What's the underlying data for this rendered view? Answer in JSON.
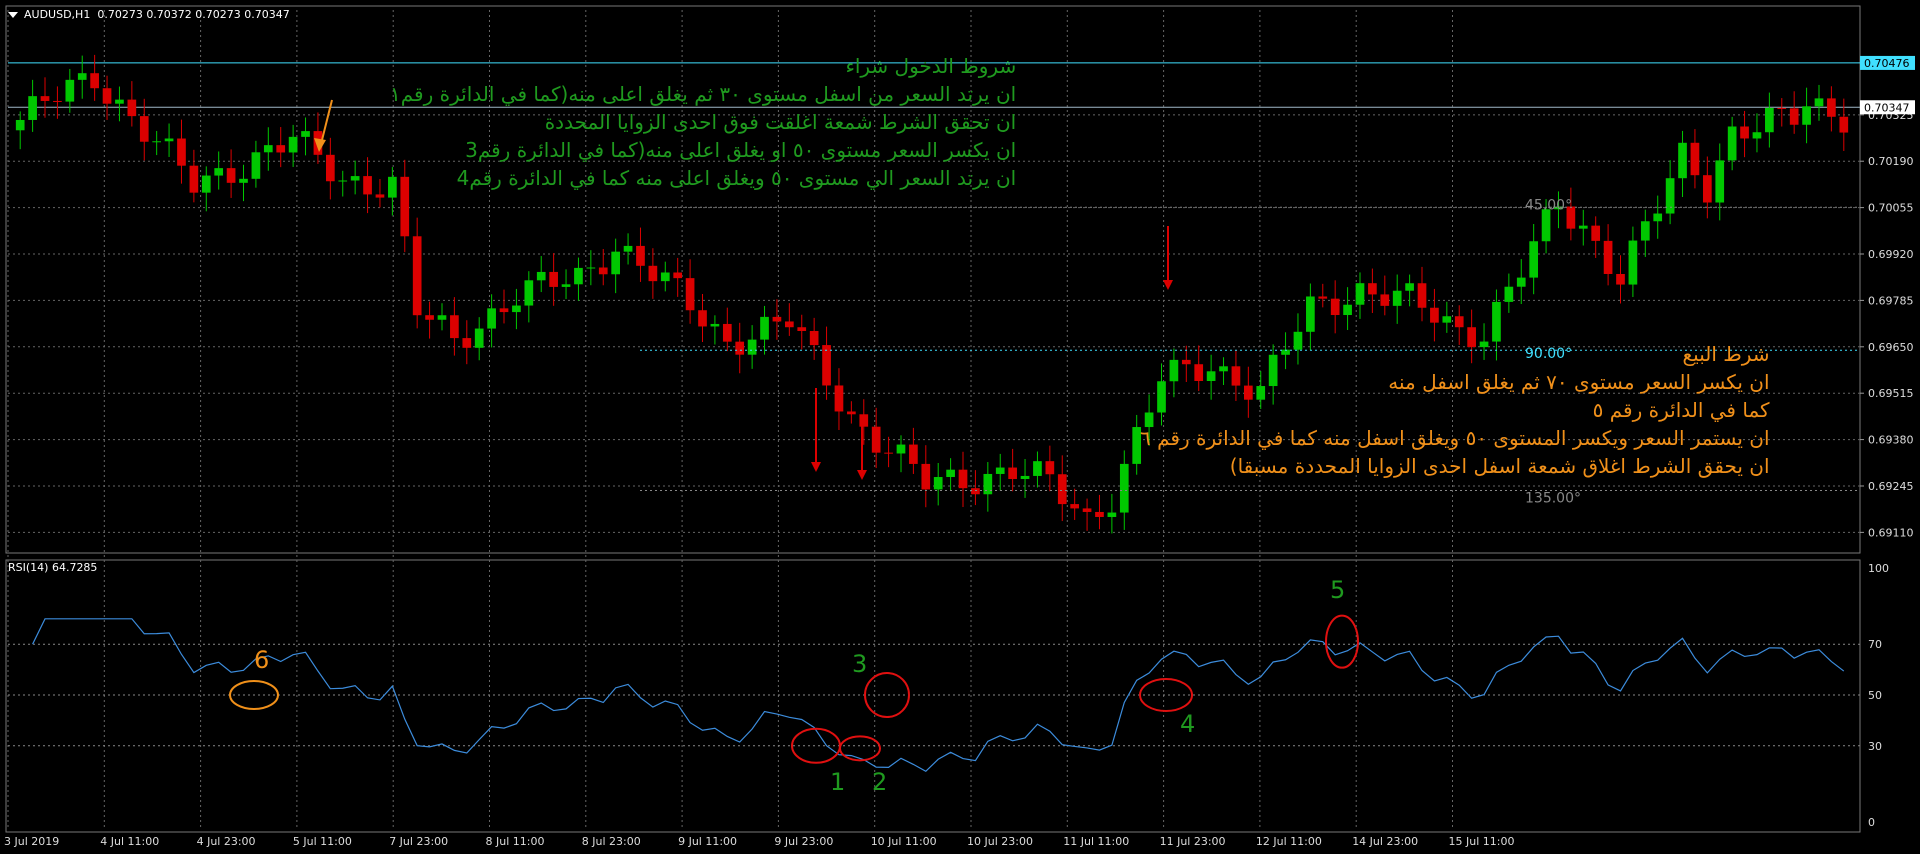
{
  "header": {
    "symbol": "AUDUSD,H1",
    "ohlc": "0.70273 0.70372 0.70273 0.70347"
  },
  "rsi_header": "RSI(14) 64.7285",
  "price_badges": [
    {
      "label": "0.70476",
      "color": "#40e0ff"
    },
    {
      "label": "0.70347",
      "color": "#ffffff"
    }
  ],
  "colors": {
    "bull": "#00c800",
    "bear": "#dc0000",
    "rsi_line": "#3c8cdc",
    "buy_text": "#1f9a1f",
    "sell_text": "#f0901a",
    "circle_red": "#e01010",
    "circle_orange": "#f0901a"
  },
  "angle_labels": [
    {
      "text": "45.00°",
      "color": "#888888"
    },
    {
      "text": "90.00°",
      "color": "#40e0ff"
    },
    {
      "text": "135.00°",
      "color": "#888888"
    }
  ],
  "buy_notes": {
    "title": "شروط الدخول شراء",
    "lines": [
      "ان يرتد السعر من اسفل مستوى ٣٠ ثم يغلق اعلى منه(كما في الدائرة رقم١",
      "ان تحقق الشرط شمعة اغلقت فوق احدى الزوايا المحددة",
      "ان يكسر السعر مستوى ٥٠ او يغلق اعلى منه(كما في الدائرة رقم3",
      "ان يرتد السعر الي مستوى ٥٠ ويغلق اعلى منه كما في الدائرة رقم4"
    ]
  },
  "sell_notes": {
    "title": "شرط البيع",
    "lines": [
      "ان يكسر السعر مستوى ٧٠ ثم يغلق اسفل منه",
      "كما في الدائرة رقم ٥",
      "ان يستمر السعر ويكسر المستوى ٥٠ ويغلق اسفل منه كما في الدائرة رقم ٦",
      "ان يحقق الشرط اغلاق شمعة اسفل احدى الزوايا المحددة مسبقا)"
    ]
  },
  "circle_labels": [
    "1",
    "2",
    "3",
    "4",
    "5",
    "6"
  ],
  "chart_data": [
    {
      "type": "candlestick",
      "title": "AUDUSD,H1",
      "ylim": [
        0.6905,
        0.7063
      ],
      "y_ticks": [
        "0.70325",
        "0.70190",
        "0.70055",
        "0.69920",
        "0.69785",
        "0.69650",
        "0.69515",
        "0.69380",
        "0.69245",
        "0.69110"
      ],
      "x_ticks": [
        "3 Jul 2019",
        "4 Jul 11:00",
        "4 Jul 23:00",
        "5 Jul 11:00",
        "7 Jul 23:00",
        "8 Jul 11:00",
        "8 Jul 23:00",
        "9 Jul 11:00",
        "9 Jul 23:00",
        "10 Jul 11:00",
        "10 Jul 23:00",
        "11 Jul 11:00",
        "11 Jul 23:00",
        "12 Jul 11:00",
        "14 Jul 23:00",
        "15 Jul 11:00"
      ],
      "horizontal_lines": [
        0.70476,
        0.70347
      ],
      "anchors": [
        [
          0,
          0.7031
        ],
        [
          6,
          0.7044
        ],
        [
          10,
          0.7028
        ],
        [
          14,
          0.7012
        ],
        [
          22,
          0.7025
        ],
        [
          26,
          0.7014
        ],
        [
          30,
          0.7012
        ],
        [
          32,
          0.6975
        ],
        [
          35,
          0.6967
        ],
        [
          40,
          0.698
        ],
        [
          45,
          0.6985
        ],
        [
          48,
          0.6995
        ],
        [
          53,
          0.698
        ],
        [
          57,
          0.6967
        ],
        [
          62,
          0.6972
        ],
        [
          67,
          0.6945
        ],
        [
          70,
          0.6935
        ],
        [
          73,
          0.6925
        ],
        [
          80,
          0.6929
        ],
        [
          83,
          0.6925
        ],
        [
          86,
          0.6915
        ],
        [
          88,
          0.6922
        ],
        [
          92,
          0.6955
        ],
        [
          96,
          0.696
        ],
        [
          100,
          0.6952
        ],
        [
          104,
          0.6976
        ],
        [
          108,
          0.6982
        ],
        [
          110,
          0.698
        ],
        [
          112,
          0.6978
        ],
        [
          116,
          0.697
        ],
        [
          118,
          0.697
        ],
        [
          121,
          0.6987
        ],
        [
          124,
          0.7006
        ],
        [
          126,
          0.7
        ],
        [
          129,
          0.6986
        ],
        [
          132,
          0.7005
        ],
        [
          134,
          0.702
        ],
        [
          136,
          0.7012
        ],
        [
          138,
          0.7028
        ],
        [
          141,
          0.703
        ],
        [
          143,
          0.7031
        ],
        [
          144,
          0.7035
        ],
        [
          147,
          0.7033
        ]
      ]
    },
    {
      "type": "line",
      "title": "RSI(14) 64.7285",
      "ylim": [
        0,
        100
      ],
      "y_ticks": [
        100,
        70,
        50,
        30,
        0
      ],
      "levels": [
        70,
        50,
        30
      ],
      "last_value": 64.7285
    }
  ]
}
